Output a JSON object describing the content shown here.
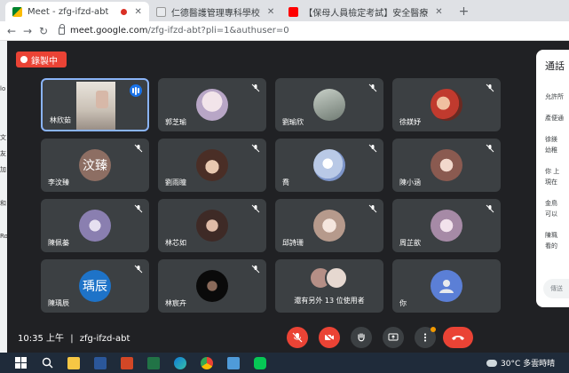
{
  "browser": {
    "tabs": [
      {
        "label": "Meet - zfg-ifzd-abt",
        "active": true,
        "recording": true
      },
      {
        "label": "仁德醫護管理專科學校",
        "active": false
      },
      {
        "label": "【保母人員檢定考試】安全醫療",
        "active": false
      }
    ],
    "new_tab": "+",
    "url_host": "meet.google.com",
    "url_path": "/zfg-ifzd-abt?pli=1&authuser=0"
  },
  "left_strip": [
    "lo",
    "文",
    "友",
    "加",
    "和",
    "Ro"
  ],
  "meet": {
    "recording_label": "錄製中",
    "tiles": [
      {
        "name": "林欣茹",
        "type": "camera",
        "speaking": true
      },
      {
        "name": "郭芝瑜",
        "type": "photo",
        "color": "#d8cfe0"
      },
      {
        "name": "劉瑜欣",
        "type": "photo",
        "color": "#9aa5a0"
      },
      {
        "name": "徐鎂妤",
        "type": "photo",
        "color": "#c86a5a"
      },
      {
        "name": "李汶臻",
        "type": "initials",
        "initials": "汶臻",
        "color": "#8d6e63"
      },
      {
        "name": "劉雨瞳",
        "type": "photo",
        "color": "#5a3a30"
      },
      {
        "name": "喬",
        "type": "photo",
        "color": "#b9c9e6"
      },
      {
        "name": "陳小涵",
        "type": "photo",
        "color": "#c9a39a"
      },
      {
        "name": "陳佩蓁",
        "type": "photo",
        "color": "#9a8fb5"
      },
      {
        "name": "林芯如",
        "type": "photo",
        "color": "#6b4a42"
      },
      {
        "name": "邱詩珊",
        "type": "photo",
        "color": "#d9c1b8"
      },
      {
        "name": "周芷歆",
        "type": "photo",
        "color": "#c0a6c0"
      },
      {
        "name": "陳瑀辰",
        "type": "initials",
        "initials": "瑀辰",
        "color": "#1e73c8"
      },
      {
        "name": "林宸卉",
        "type": "photo",
        "color": "#111111"
      },
      {
        "name": "還有另外 13 位使用者",
        "type": "others"
      },
      {
        "name": "你",
        "type": "self",
        "color": "#5b7fd6"
      }
    ],
    "side_panel": {
      "title": "通話",
      "items": [
        "允許所",
        "產便通",
        "徐鎂",
        "幼稚",
        "你 上",
        "現在",
        "金鳥",
        "可以",
        "陳珮",
        "看的"
      ],
      "input_placeholder": "傳送"
    },
    "meeting_time": "10:35 上午",
    "meeting_code": "zfg-ifzd-abt",
    "controls": [
      {
        "name": "mic",
        "icon": "mic-off-icon"
      },
      {
        "name": "camera",
        "icon": "camera-off-icon"
      },
      {
        "name": "raise-hand",
        "icon": "hand-icon"
      },
      {
        "name": "present",
        "icon": "present-icon"
      },
      {
        "name": "more",
        "icon": "more-icon"
      },
      {
        "name": "end-call",
        "icon": "end-call-icon"
      }
    ]
  },
  "taskbar": {
    "weather": "30°C 多雲時晴"
  }
}
